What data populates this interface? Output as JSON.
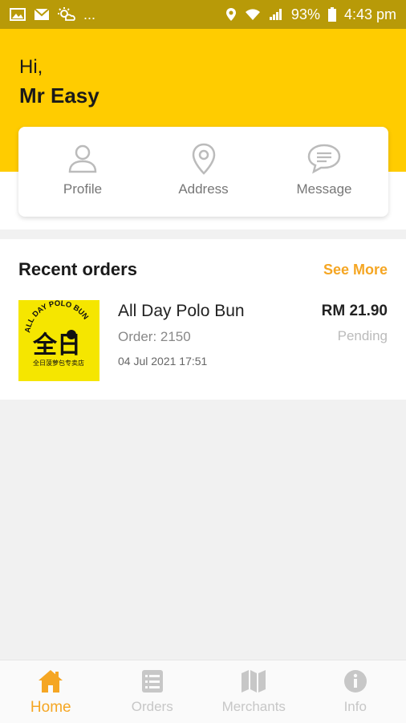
{
  "status_bar": {
    "notifications_more": "...",
    "battery_percent": "93%",
    "time": "4:43 pm"
  },
  "header": {
    "greeting": "Hi,",
    "user_name": "Mr Easy"
  },
  "quick_actions": [
    {
      "label": "Profile",
      "icon": "person-icon"
    },
    {
      "label": "Address",
      "icon": "location-pin-icon"
    },
    {
      "label": "Message",
      "icon": "chat-bubble-icon"
    }
  ],
  "recent_orders": {
    "title": "Recent orders",
    "see_more_label": "See More",
    "items": [
      {
        "merchant": "All Day Polo Bun",
        "order_number": "Order: 2150",
        "date": "04 Jul 2021 17:51",
        "amount": "RM 21.90",
        "status": "Pending",
        "logo_text_top": "ALL DAY POLO BUN",
        "logo_text_main": "全日",
        "logo_text_bottom": "全日菠萝包专卖店"
      }
    ]
  },
  "bottom_nav": [
    {
      "label": "Home",
      "icon": "home-icon",
      "active": true
    },
    {
      "label": "Orders",
      "icon": "list-icon",
      "active": false
    },
    {
      "label": "Merchants",
      "icon": "map-icon",
      "active": false
    },
    {
      "label": "Info",
      "icon": "info-icon",
      "active": false
    }
  ],
  "colors": {
    "brand_yellow": "#ffcc00",
    "accent_orange": "#f5a623",
    "status_bar": "#b89a08"
  }
}
